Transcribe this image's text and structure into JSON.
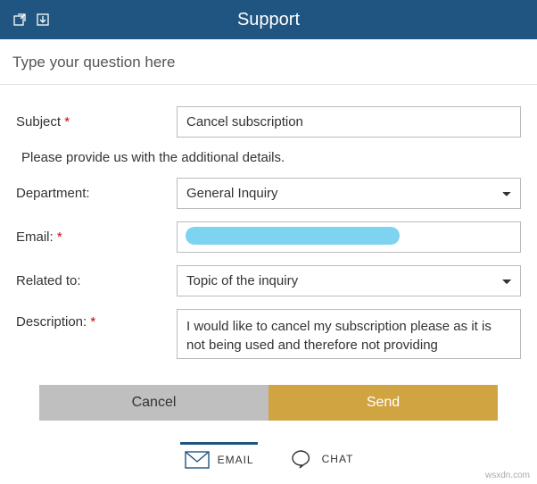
{
  "header": {
    "title": "Support"
  },
  "question": {
    "placeholder": "Type your question here"
  },
  "form": {
    "subject_label": "Subject",
    "subject_value": "Cancel subscription",
    "info_text": "Please provide us with the additional details.",
    "department_label": "Department:",
    "department_value": "General Inquiry",
    "email_label": "Email:",
    "email_value": "",
    "related_label": "Related to:",
    "related_value": "Topic of the inquiry",
    "description_label": "Description:",
    "description_value": "I would like to cancel my subscription please as it is not being used and therefore not providing"
  },
  "buttons": {
    "cancel": "Cancel",
    "send": "Send"
  },
  "tabs": {
    "email": "EMAIL",
    "chat": "CHAT"
  },
  "attribution": "wsxdn.com"
}
